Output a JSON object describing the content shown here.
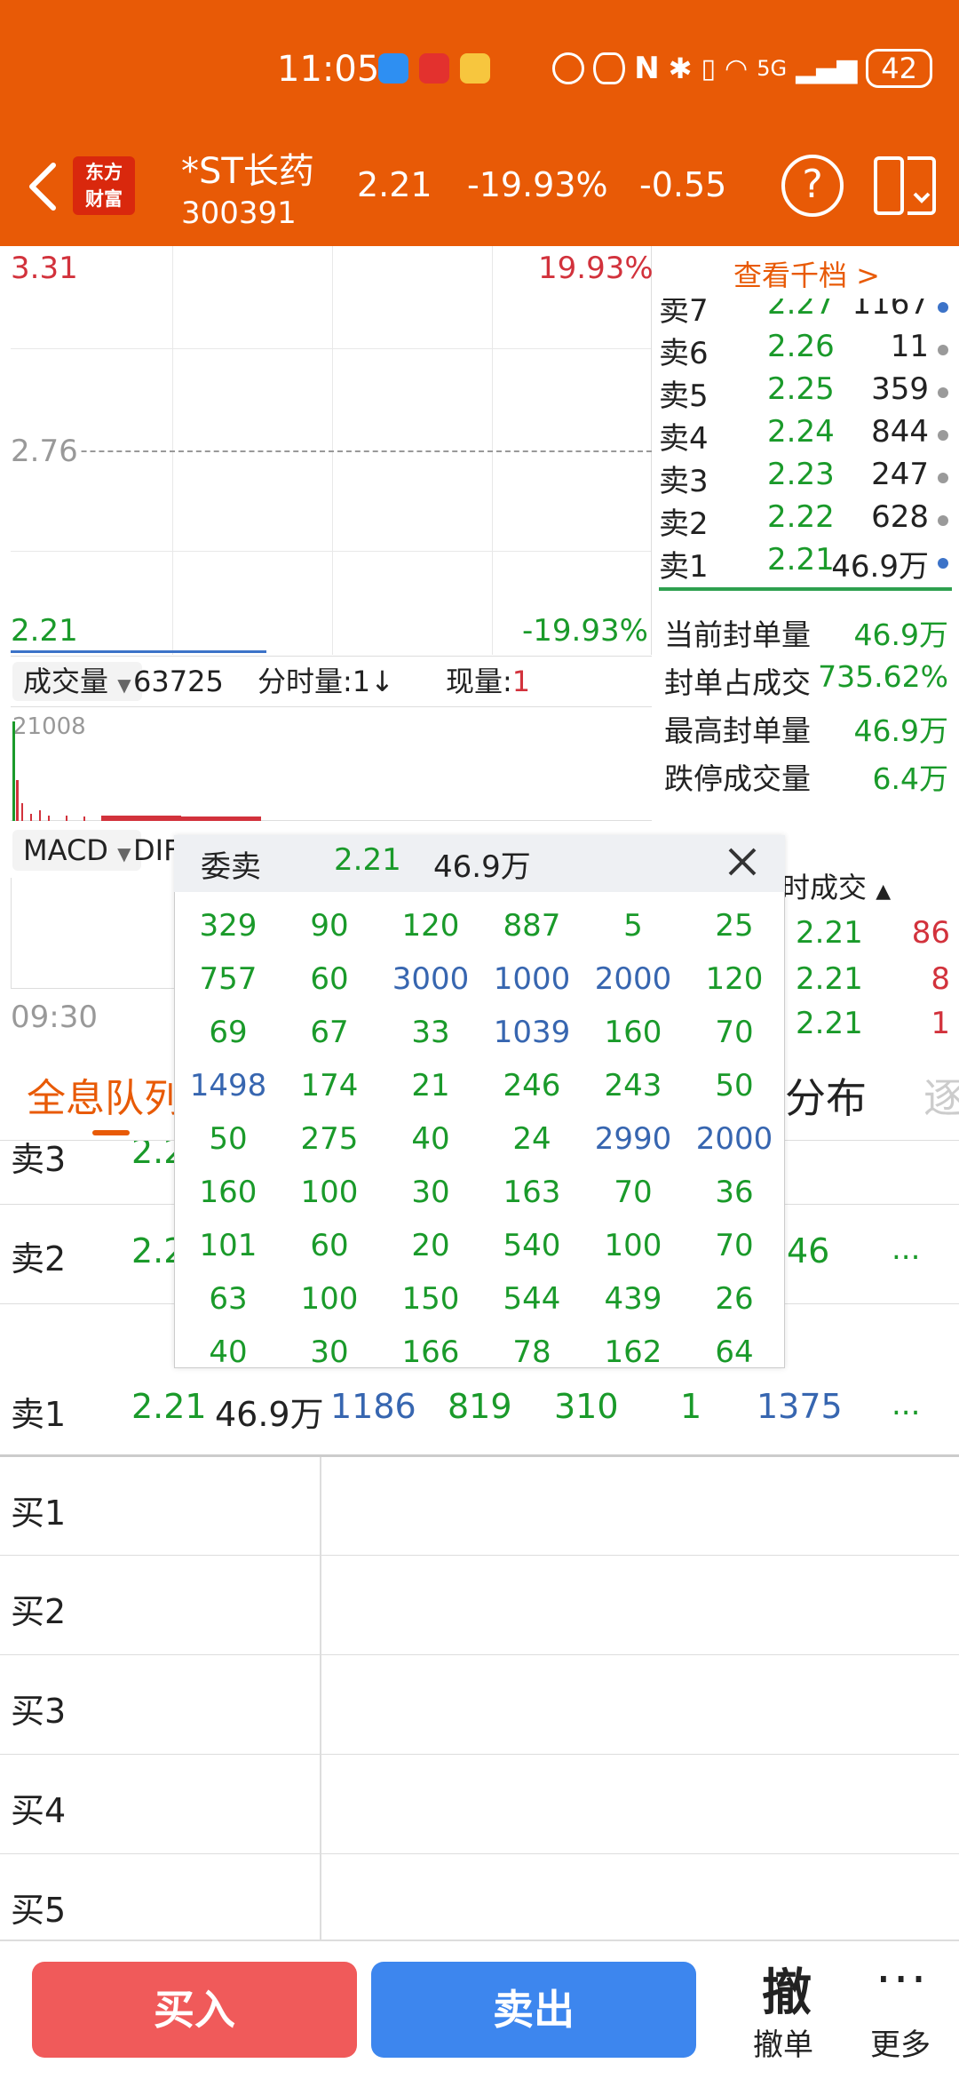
{
  "status_bar": {
    "time": "11:05",
    "battery": "42",
    "network": "5G"
  },
  "header": {
    "logo_line1": "东方",
    "logo_line2": "财富",
    "stock_name": "*ST长药",
    "stock_code": "300391",
    "price": "2.21",
    "change_pct": "-19.93%",
    "change": "-0.55"
  },
  "chart": {
    "high_price": "3.31",
    "high_pct": "19.93%",
    "mid_price": "2.76",
    "low_price": "2.21",
    "low_pct": "-19.93%",
    "start_time": "09:30"
  },
  "volume": {
    "selector": "成交量",
    "total": "63725",
    "fsl_label": "分时量:1",
    "fsl_arrow": "↓",
    "current_label": "现量:",
    "current_value": "1",
    "max_label": "21008"
  },
  "macd": {
    "selector": "MACD",
    "dif_label": "DIF"
  },
  "orderbook": {
    "link": "查看千档 >",
    "rows": [
      {
        "label": "卖7",
        "price": "2.27",
        "vol": "1167",
        "dot": "#3c73c8"
      },
      {
        "label": "卖6",
        "price": "2.26",
        "vol": "11",
        "dot": "#9a9a9a"
      },
      {
        "label": "卖5",
        "price": "2.25",
        "vol": "359",
        "dot": "#9a9a9a"
      },
      {
        "label": "卖4",
        "price": "2.24",
        "vol": "844",
        "dot": "#9a9a9a"
      },
      {
        "label": "卖3",
        "price": "2.23",
        "vol": "247",
        "dot": "#9a9a9a"
      },
      {
        "label": "卖2",
        "price": "2.22",
        "vol": "628",
        "dot": "#9a9a9a"
      },
      {
        "label": "卖1",
        "price": "2.21",
        "vol": "46.9万",
        "dot": "#3c73c8"
      }
    ]
  },
  "seal_stats": [
    {
      "label": "当前封单量",
      "value": "46.9万"
    },
    {
      "label": "封单占成交",
      "value": "735.62%"
    },
    {
      "label": "最高封单量",
      "value": "46.9万"
    },
    {
      "label": "跌停成交量",
      "value": "6.4万"
    }
  ],
  "trades": {
    "header": "时成交",
    "rows": [
      {
        "price": "2.21",
        "vol": "86"
      },
      {
        "price": "2.21",
        "vol": "8"
      },
      {
        "price": "2.21",
        "vol": "1"
      }
    ]
  },
  "tabs": {
    "active": "全息队列",
    "distribution": "分布",
    "faded": "逐"
  },
  "queue": {
    "rows": [
      {
        "label": "卖3",
        "price": "2.2"
      },
      {
        "label": "卖2",
        "price": "2.2",
        "partial": "46",
        "more": "..."
      },
      {
        "label": "卖1",
        "price": "2.21",
        "vol": "46.9万",
        "nums": [
          "1186",
          "819",
          "310",
          "1",
          "1375"
        ],
        "more": "..."
      },
      {
        "label": "买1"
      },
      {
        "label": "买2"
      },
      {
        "label": "买3"
      },
      {
        "label": "买4"
      },
      {
        "label": "买5"
      }
    ]
  },
  "popup": {
    "title": "委卖",
    "price": "2.21",
    "total": "46.9万",
    "cells": [
      [
        "329",
        "90",
        "120",
        "887",
        "5",
        "25"
      ],
      [
        "757",
        "60",
        "3000",
        "1000",
        "2000",
        "120"
      ],
      [
        "69",
        "67",
        "33",
        "1039",
        "160",
        "70"
      ],
      [
        "1498",
        "174",
        "21",
        "246",
        "243",
        "50"
      ],
      [
        "50",
        "275",
        "40",
        "24",
        "2990",
        "2000"
      ],
      [
        "160",
        "100",
        "30",
        "163",
        "70",
        "36"
      ],
      [
        "101",
        "60",
        "20",
        "540",
        "100",
        "70"
      ],
      [
        "63",
        "100",
        "150",
        "544",
        "439",
        "26"
      ],
      [
        "40",
        "30",
        "166",
        "78",
        "162",
        "64"
      ]
    ],
    "colors": {
      "normal": "#1a9a2a",
      "large": "#3766b0"
    }
  },
  "bottom": {
    "buy": "买入",
    "sell": "卖出",
    "cancel_big": "撤",
    "cancel_label": "撤单",
    "more_dots": "···",
    "more_label": "更多"
  }
}
